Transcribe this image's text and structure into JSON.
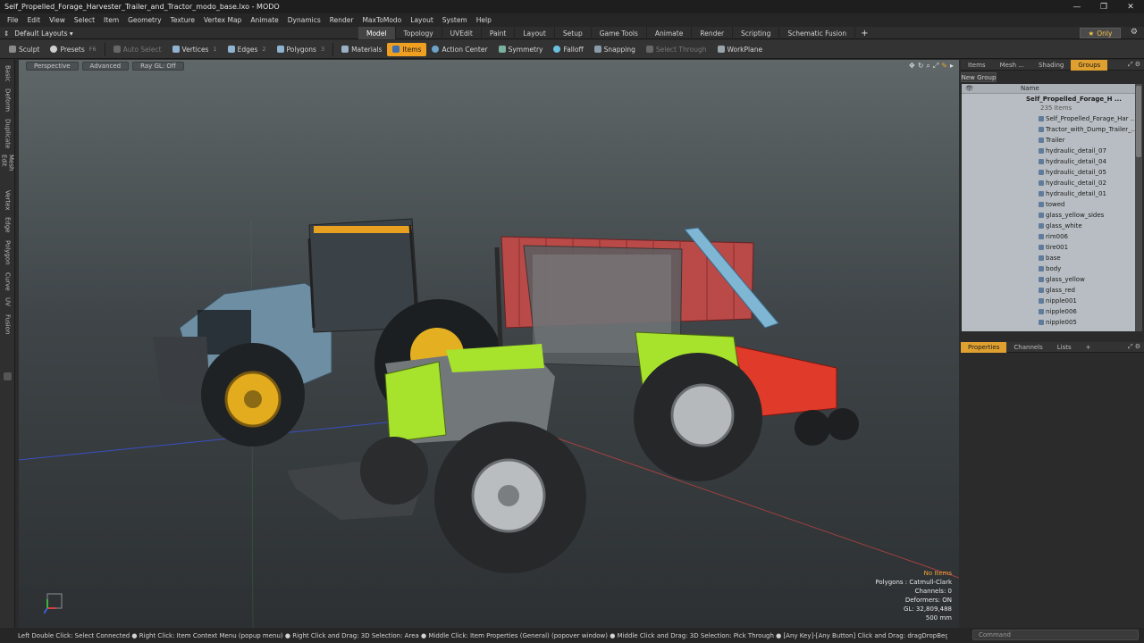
{
  "window": {
    "title": "Self_Propelled_Forage_Harvester_Trailer_and_Tractor_modo_base.lxo - MODO",
    "controls": [
      "—",
      "❐",
      "✕"
    ]
  },
  "menu": [
    "File",
    "Edit",
    "View",
    "Select",
    "Item",
    "Geometry",
    "Texture",
    "Vertex Map",
    "Animate",
    "Dynamics",
    "Render",
    "MaxToModo",
    "Layout",
    "System",
    "Help"
  ],
  "layouts": {
    "label": "Default Layouts ▾"
  },
  "tabs": [
    {
      "label": "Model",
      "active": true
    },
    {
      "label": "Topology"
    },
    {
      "label": "UVEdit"
    },
    {
      "label": "Paint"
    },
    {
      "label": "Layout"
    },
    {
      "label": "Setup"
    },
    {
      "label": "Game Tools"
    },
    {
      "label": "Animate"
    },
    {
      "label": "Render"
    },
    {
      "label": "Scripting"
    },
    {
      "label": "Schematic Fusion"
    }
  ],
  "tabplus": "+",
  "only": {
    "label": "Only",
    "star": "★"
  },
  "toolbar": {
    "sculpt": "Sculpt",
    "presets": "Presets",
    "presets_key": "F6",
    "autoselect": "Auto Select",
    "vertices": "Vertices",
    "vertices_key": "1",
    "edges": "Edges",
    "edges_key": "2",
    "polygons": "Polygons",
    "polygons_key": "3",
    "materials": "Materials",
    "items": "Items",
    "actioncenter": "Action Center",
    "symmetry": "Symmetry",
    "falloff": "Falloff",
    "snapping": "Snapping",
    "selectthrough": "Select Through",
    "workplane": "WorkPlane"
  },
  "lefttabs": [
    "Basic",
    "Deform",
    "Duplicate",
    "Mesh Edit",
    "Vertex",
    "Edge",
    "Polygon",
    "Curve",
    "UV",
    "Fusion"
  ],
  "viewport": {
    "view": "Perspective",
    "shading": "Advanced",
    "raygl": "Ray GL: Off",
    "stats": {
      "noitems": "No Items",
      "polygons": "Polygons : Catmull-Clark",
      "channels": "Channels: 0",
      "deformers": "Deformers: ON",
      "gl": "GL: 32,809,488",
      "unit": "500 mm"
    }
  },
  "rightpanel": {
    "toptabs": [
      "Items",
      "Mesh ...",
      "Shading",
      "Groups"
    ],
    "activetab": "Groups",
    "newgroup": "New Group",
    "colname": "Name",
    "root": {
      "name": "Self_Propelled_Forage_H ...",
      "count": "235 Items"
    },
    "items": [
      "Self_Propelled_Forage_Har ...",
      "Tractor_with_Dump_Trailer_...",
      "Trailer",
      "hydraulic_detail_07",
      "hydraulic_detail_04",
      "hydraulic_detail_05",
      "hydraulic_detail_02",
      "hydraulic_detail_01",
      "towed",
      "glass_yellow_sides",
      "glass_white",
      "rim006",
      "tire001",
      "base",
      "body",
      "glass_yellow",
      "glass_red",
      "nipple001",
      "nipple006",
      "nipple005"
    ],
    "bottomtabs": [
      "Properties",
      "Channels",
      "Lists"
    ],
    "bottomactive": "Properties"
  },
  "status": {
    "message": "Left Double Click: Select Connected ● Right Click: Item Context Menu (popup menu) ● Right Click and Drag: 3D Selection: Area ● Middle Click: Item Properties (General) (popover window) ● Middle Click and Drag: 3D Selection: Pick Through ● [Any Key]-[Any Button] Click and Drag: dragDropBegin",
    "command_placeholder": "Command"
  },
  "colors": {
    "accent": "#f0a020",
    "harvesterRed": "#e03a2a",
    "tractorLime": "#a8e030",
    "tractorBlue": "#6a8ba0",
    "rimYellow": "#e8b020"
  }
}
